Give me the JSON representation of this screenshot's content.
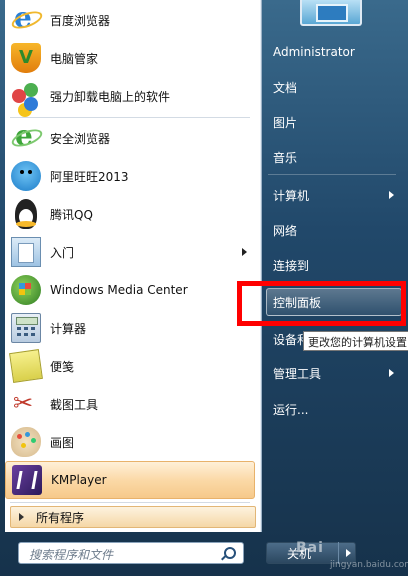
{
  "programs": [
    {
      "label": "百度浏览器",
      "icon": "baidu-browser-icon"
    },
    {
      "label": "电脑管家",
      "icon": "pc-manager-shield-icon"
    },
    {
      "label": "强力卸载电脑上的软件",
      "icon": "uninstall-tool-icon"
    },
    {
      "label": "安全浏览器",
      "icon": "safe-browser-icon"
    },
    {
      "label": "阿里旺旺2013",
      "icon": "aliwangwang-icon"
    },
    {
      "label": "腾讯QQ",
      "icon": "qq-penguin-icon"
    },
    {
      "label": "入门",
      "icon": "getting-started-icon"
    },
    {
      "label": "Windows Media Center",
      "icon": "media-center-icon"
    },
    {
      "label": "计算器",
      "icon": "calculator-icon"
    },
    {
      "label": "便笺",
      "icon": "sticky-notes-icon"
    },
    {
      "label": "截图工具",
      "icon": "snipping-tool-icon"
    },
    {
      "label": "画图",
      "icon": "paint-icon"
    },
    {
      "label": "KMPlayer",
      "icon": "kmplayer-icon"
    }
  ],
  "all_programs": "所有程序",
  "search": {
    "placeholder": "搜索程序和文件"
  },
  "right_links": [
    {
      "label": "Administrator"
    },
    {
      "label": "文档"
    },
    {
      "label": "图片"
    },
    {
      "label": "音乐"
    },
    {
      "label": "计算机"
    },
    {
      "label": "网络"
    },
    {
      "label": "连接到"
    },
    {
      "label": "控制面板"
    },
    {
      "label": "设备和"
    },
    {
      "label": "管理工具"
    },
    {
      "label": "运行..."
    }
  ],
  "tooltip": "更改您的计算机设置",
  "shutdown_label": "关机",
  "watermark": "Bai",
  "watermark_sub": "jingyan.baidu.com",
  "colors": {
    "highlight_border": "#ff0000",
    "accent": "#f6c98a"
  }
}
